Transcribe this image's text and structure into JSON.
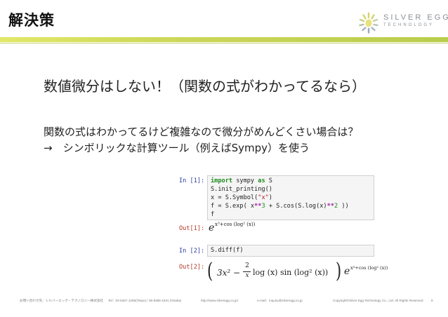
{
  "header": {
    "title": "解決策",
    "logo_name": "SILVER EGG",
    "logo_sub": "TECHNOLOGY"
  },
  "slide": {
    "subtitle": "数値微分はしない！（関数の式がわかってるなら）",
    "line1": "関数の式はわかってるけど複雑なので微分がめんどくさい場合は？",
    "line2": "→　シンボリックな計算ツール（例えばSympy）を使う"
  },
  "notebook": {
    "in1_prompt": "In [1]:",
    "in1_lines": {
      "l1_kw1": "import",
      "l1_mid": " sympy ",
      "l1_kw2": "as",
      "l1_end": " S",
      "l2": "S.init_printing()",
      "l3_pre": "x = S.Symbol(",
      "l3_str": "\"x\"",
      "l3_post": ")",
      "l4_pre": "f = S.exp( x",
      "l4_op1": "**",
      "l4_num1": "3",
      "l4_mid1": " + S.cos(S.log(x)",
      "l4_op2": "**",
      "l4_num2": "2",
      "l4_end": " ))",
      "l5": "f"
    },
    "out1_prompt": "Out[1]:",
    "out1_base": "e",
    "out1_exp": "x³+cos (log² (x))",
    "in2_prompt": "In [2]:",
    "in2_code": "S.diff(f)",
    "out2_prompt": "Out[2]:",
    "out2_lparen": "(",
    "out2_a": "3x² −",
    "out2_num": "2",
    "out2_den": "x",
    "out2_b": "log (x) sin (log² (x))",
    "out2_rparen": ")",
    "out2_base": "e",
    "out2_exp": "x³+cos (log² (x))"
  },
  "footer": {
    "contact": "お問い合わせ先：シルバーエッグ・テクノロジー株式会社",
    "tel": "Tel：03-5357-1255(Tokyo) / 06-6386-1931 (Osaka)",
    "url": "http://www.silveregg.co.jp/",
    "email": "e-mail：inquiry@silveregg.co.jp",
    "copyright": "Copyright©Silver Egg Technology Co., Ltd. All Rights Reserved.",
    "page": "8"
  },
  "colors": {
    "accent_bar": "#cbd758",
    "in_prompt": "#2c3f9e",
    "out_prompt": "#b33a2a"
  }
}
